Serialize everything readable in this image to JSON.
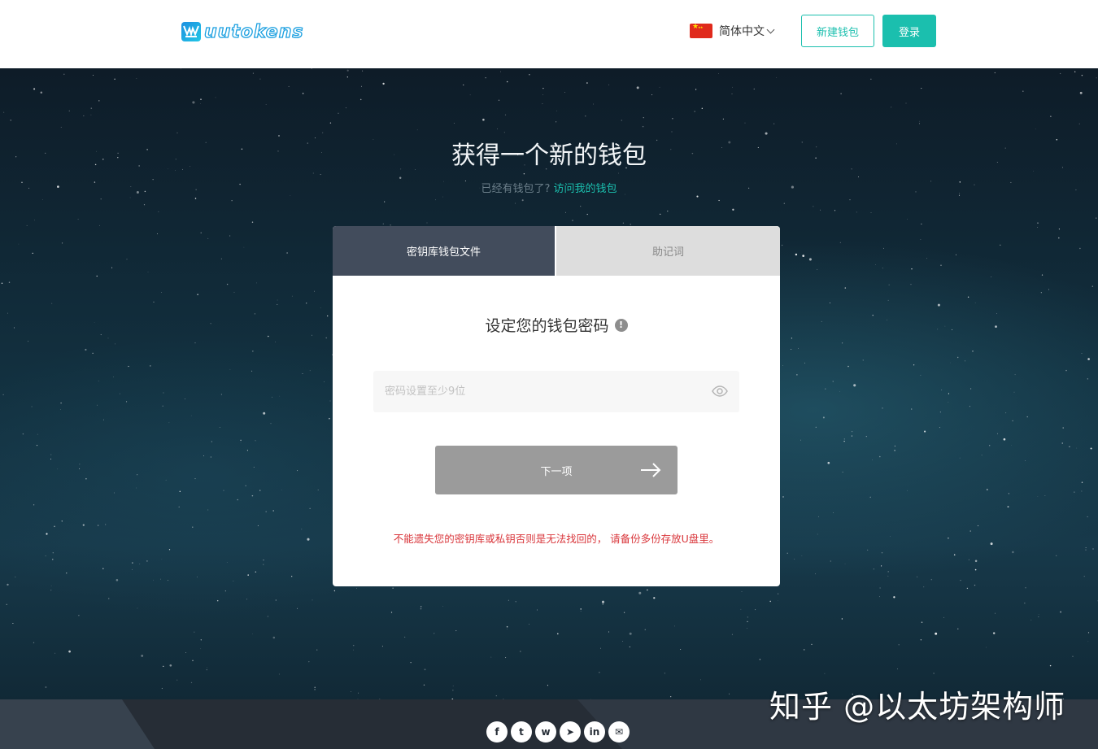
{
  "header": {
    "logo_text": "uutokens",
    "language_label": "简体中文",
    "new_wallet_label": "新建钱包",
    "login_label": "登录"
  },
  "hero": {
    "title": "获得一个新的钱包",
    "subtitle_prefix": "已经有钱包了?",
    "subtitle_link": "访问我的钱包"
  },
  "card": {
    "tabs": [
      {
        "label": "密钥库钱包文件",
        "active": true
      },
      {
        "label": "助记词",
        "active": false
      }
    ],
    "title": "设定您的钱包密码",
    "info_icon": "!",
    "password_placeholder": "密码设置至少9位",
    "next_label": "下一项",
    "warning": "不能遗失您的密钥库或私钥否则是无法找回的， 请备份多份存放U盘里。"
  },
  "socials": [
    {
      "name": "facebook-icon",
      "glyph": "f"
    },
    {
      "name": "twitter-icon",
      "glyph": "t"
    },
    {
      "name": "weibo-icon",
      "glyph": "w"
    },
    {
      "name": "telegram-icon",
      "glyph": "➤"
    },
    {
      "name": "linkedin-icon",
      "glyph": "in"
    },
    {
      "name": "wechat-icon",
      "glyph": "✉"
    }
  ],
  "watermark": "知乎 @以太坊架构师",
  "colors": {
    "accent": "#1bbfae",
    "tab_active": "#424c5c",
    "warning": "#d9363b",
    "next_button": "#9b9b9b"
  }
}
